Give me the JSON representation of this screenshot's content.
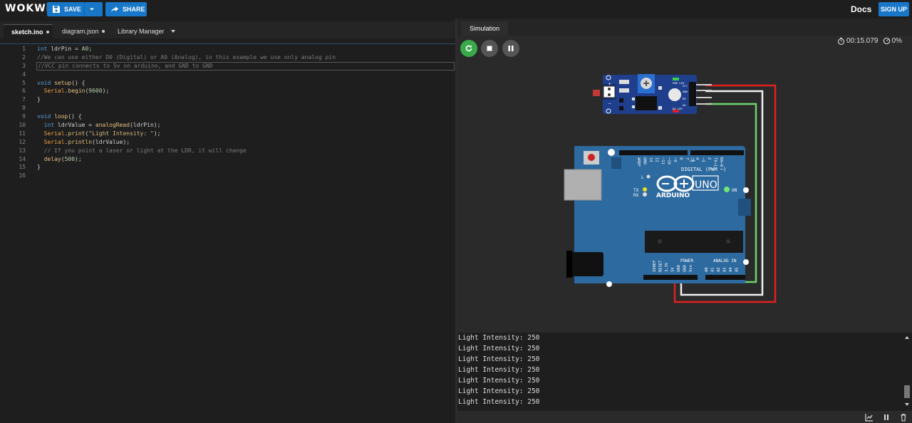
{
  "header": {
    "logo": "WOKWi",
    "save_label": "SAVE",
    "share_label": "SHARE",
    "docs_label": "Docs",
    "signup_label": "SIGN UP"
  },
  "editor": {
    "tabs": [
      {
        "label": "sketch.ino"
      },
      {
        "label": "diagram.json"
      },
      {
        "label": "Library Manager"
      }
    ],
    "lines": [
      {
        "n": "1",
        "tokens": [
          [
            "kw",
            "int"
          ],
          [
            "t",
            " ldrPin = "
          ],
          [
            "num",
            "A0"
          ],
          [
            "t",
            ";"
          ]
        ]
      },
      {
        "n": "2",
        "tokens": [
          [
            "cm",
            "//We can use either D0 (Digital) or A0 (Analog), in this example we use only analog pin"
          ]
        ]
      },
      {
        "n": "3",
        "tokens": [
          [
            "cm",
            "//VCC pin connects to 5v on arduino, and GND to GND"
          ]
        ]
      },
      {
        "n": "4",
        "tokens": []
      },
      {
        "n": "5",
        "tokens": [
          [
            "kw",
            "void"
          ],
          [
            "t",
            " "
          ],
          [
            "fn",
            "setup"
          ],
          [
            "t",
            "() {"
          ]
        ]
      },
      {
        "n": "6",
        "tokens": [
          [
            "t",
            "  "
          ],
          [
            "ser",
            "Serial"
          ],
          [
            "t",
            "."
          ],
          [
            "fn",
            "begin"
          ],
          [
            "t",
            "("
          ],
          [
            "num",
            "9600"
          ],
          [
            "t",
            ");"
          ]
        ]
      },
      {
        "n": "7",
        "tokens": [
          [
            "t",
            "}"
          ]
        ]
      },
      {
        "n": "8",
        "tokens": []
      },
      {
        "n": "9",
        "tokens": [
          [
            "kw",
            "void"
          ],
          [
            "t",
            " "
          ],
          [
            "fn",
            "loop"
          ],
          [
            "t",
            "() {"
          ]
        ]
      },
      {
        "n": "10",
        "tokens": [
          [
            "t",
            "  "
          ],
          [
            "kw",
            "int"
          ],
          [
            "t",
            " ldrValue = "
          ],
          [
            "fn",
            "analogRead"
          ],
          [
            "t",
            "(ldrPin);"
          ]
        ]
      },
      {
        "n": "11",
        "tokens": [
          [
            "t",
            "  "
          ],
          [
            "ser",
            "Serial"
          ],
          [
            "t",
            "."
          ],
          [
            "fn",
            "print"
          ],
          [
            "t",
            "("
          ],
          [
            "str",
            "\"Light Intensity: \""
          ],
          [
            "t",
            ");"
          ]
        ]
      },
      {
        "n": "12",
        "tokens": [
          [
            "t",
            "  "
          ],
          [
            "ser",
            "Serial"
          ],
          [
            "t",
            "."
          ],
          [
            "fn",
            "println"
          ],
          [
            "t",
            "(ldrValue);"
          ]
        ]
      },
      {
        "n": "13",
        "tokens": [
          [
            "t",
            "  "
          ],
          [
            "cm",
            "// If you point a laser or light at the LDR, it will change"
          ]
        ]
      },
      {
        "n": "14",
        "tokens": [
          [
            "t",
            "  "
          ],
          [
            "fn",
            "delay"
          ],
          [
            "t",
            "("
          ],
          [
            "num",
            "500"
          ],
          [
            "t",
            ");"
          ]
        ]
      },
      {
        "n": "15",
        "tokens": [
          [
            "t",
            "}"
          ]
        ]
      },
      {
        "n": "16",
        "tokens": []
      }
    ],
    "current_line": "3"
  },
  "simulation": {
    "tab_label": "Simulation",
    "timer": "00:15.079",
    "cpu": "0%",
    "board": {
      "logo_text": "ARDUINO",
      "model": "UNO",
      "on_label": "ON",
      "tx_label": "TX",
      "rx_label": "RX",
      "l_label": "L",
      "digital_label": "DIGITAL (PWM ~)",
      "power_label": "POWER",
      "analog_label": "ANALOG IN",
      "digital_pins": [
        "AREF",
        "GND",
        "13",
        "12",
        "~11",
        "~10",
        "~9",
        "8",
        "7",
        "~6",
        "~5",
        "4",
        "~3",
        "2",
        "TX→1",
        "RX←0"
      ],
      "power_pins": [
        "IOREF",
        "RESET",
        "3.3V",
        "5V",
        "GND",
        "GND",
        "Vin"
      ],
      "analog_pins": [
        "A0",
        "A1",
        "A2",
        "A3",
        "A4",
        "A5"
      ]
    },
    "sensor": {
      "labels": [
        "PWR LED",
        "VCC",
        "GND",
        "DO",
        "AO",
        "DO LED"
      ]
    },
    "serial_lines": [
      "Light Intensity: 250",
      "Light Intensity: 250",
      "Light Intensity: 250",
      "Light Intensity: 250",
      "Light Intensity: 250",
      "Light Intensity: 250",
      "Light Intensity: 250",
      "Light Intensity: 250"
    ]
  },
  "colors": {
    "accent": "#1877c9",
    "board": "#2d6a9f",
    "wire_red": "#e02020",
    "wire_white": "#ffffff",
    "wire_green": "#6ed36e",
    "restart": "#3aa94a"
  }
}
